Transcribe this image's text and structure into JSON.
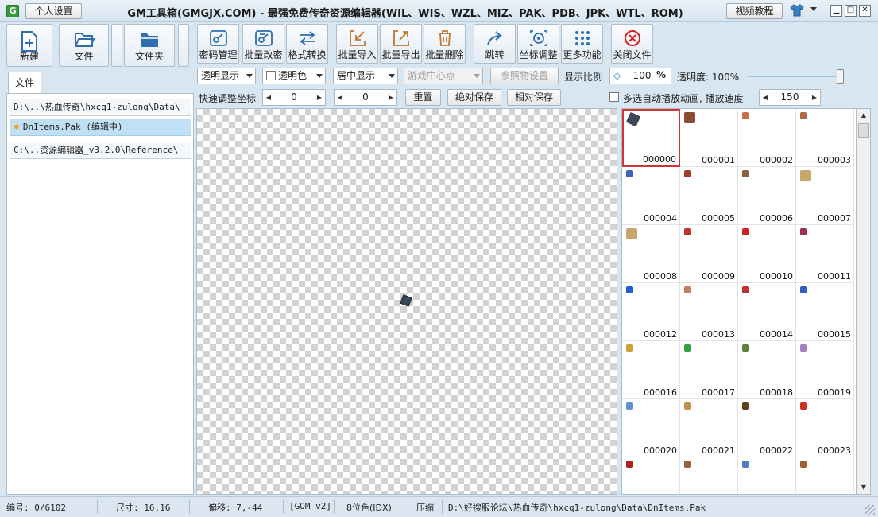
{
  "titlebar": {
    "app_icon_letter": "G",
    "personal_settings": "个人设置",
    "title": "GM工具箱(GMGJX.COM) - 最强免费传奇资源编辑器(WIL、WIS、WZL、MIZ、PAK、PDB、JPK、WTL、ROM)",
    "video_tutorial": "视频教程",
    "minimize": "▁",
    "maximize": "□",
    "close": "✕"
  },
  "left_toolbar": {
    "new": "新建",
    "file": "文件",
    "folder": "文件夹"
  },
  "file_panel": {
    "tab": "文件",
    "items": [
      "D:\\..\\热血传奇\\hxcq1-zulong\\Data\\",
      "DnItems.Pak (编辑中)",
      "C:\\..资源编辑器_v3.2.0\\Reference\\"
    ]
  },
  "main_toolbar": {
    "buttons": [
      "密码管理",
      "批量改密",
      "格式转换",
      "批量导入",
      "批量导出",
      "批量删除",
      "跳转",
      "坐标调整",
      "更多功能",
      "关闭文件"
    ]
  },
  "options": {
    "display_mode": "透明显示",
    "transparent_color": "透明色",
    "align_mode": "居中显示",
    "game_center": "游戏中心点",
    "reference_settings": "参照物设置",
    "scale_label": "显示比例",
    "scale_value": "100",
    "scale_unit": "%",
    "opacity_label": "透明度: 100%",
    "opacity_value": 1.0
  },
  "coords": {
    "label": "快速调整坐标",
    "x": "0",
    "y": "0",
    "reset": "重置",
    "abs_save": "绝对保存",
    "rel_save": "相对保存",
    "auto_play": "多选自动播放动画, 播放速度",
    "speed": "150"
  },
  "grid": {
    "cells": [
      "000000",
      "000001",
      "000002",
      "000003",
      "000004",
      "000005",
      "000006",
      "000007",
      "000008",
      "000009",
      "000010",
      "000011",
      "000012",
      "000013",
      "000014",
      "000015",
      "000016",
      "000017",
      "000018",
      "000019",
      "000020",
      "000021",
      "000022",
      "000023",
      "",
      "",
      "",
      ""
    ],
    "thumb_colors": [
      "#3c4856",
      "#8b4a32",
      "#c8704a",
      "#b06a48",
      "#4060c0",
      "#a04030",
      "#8a6040",
      "#c9a870",
      "#c9a870",
      "#c03030",
      "#d02020",
      "#a03050",
      "#2060d0",
      "#c08060",
      "#c03030",
      "#3060c0",
      "#d0a030",
      "#30a040",
      "#608040",
      "#a080c0",
      "#6090d0",
      "#c09050",
      "#604020",
      "#d03020",
      "#b02020",
      "#906040",
      "#5080c0",
      "#a06030"
    ]
  },
  "statusbar": {
    "index": "编号: 0/6102",
    "size": "尺寸: 16,16",
    "offset": "偏移: 7,-44",
    "format": "[GOM v2]",
    "color_depth": "8位色(IDX)",
    "compress": "压缩",
    "path": "D:\\好搜服论坛\\热血传奇\\hxcq1-zulong\\Data\\DnItems.Pak"
  }
}
